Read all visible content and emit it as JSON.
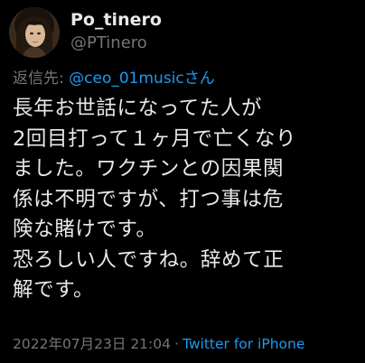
{
  "author": {
    "display_name": "Po_tinero",
    "handle": "@PTinero"
  },
  "reply": {
    "label": "返信先: ",
    "target": "@ceo_01musicさん"
  },
  "tweet": {
    "lines": [
      "長年お世話になってた人が",
      "2回目打って１ヶ月で亡くなり",
      "ました。ワクチンとの因果関",
      "係は不明ですが、打つ事は危",
      "険な賭けです。",
      "恐ろしい人ですね。辞めて正",
      "解です。"
    ]
  },
  "meta": {
    "timestamp": "2022年07月23日 21:04",
    "separator": "·",
    "source": "Twitter for iPhone"
  },
  "colors": {
    "background": "#000000",
    "text": "#e7e9ea",
    "secondary": "#71767b",
    "link": "#1d9bf0"
  },
  "icons": {
    "avatar": "profile-avatar-illustration"
  }
}
